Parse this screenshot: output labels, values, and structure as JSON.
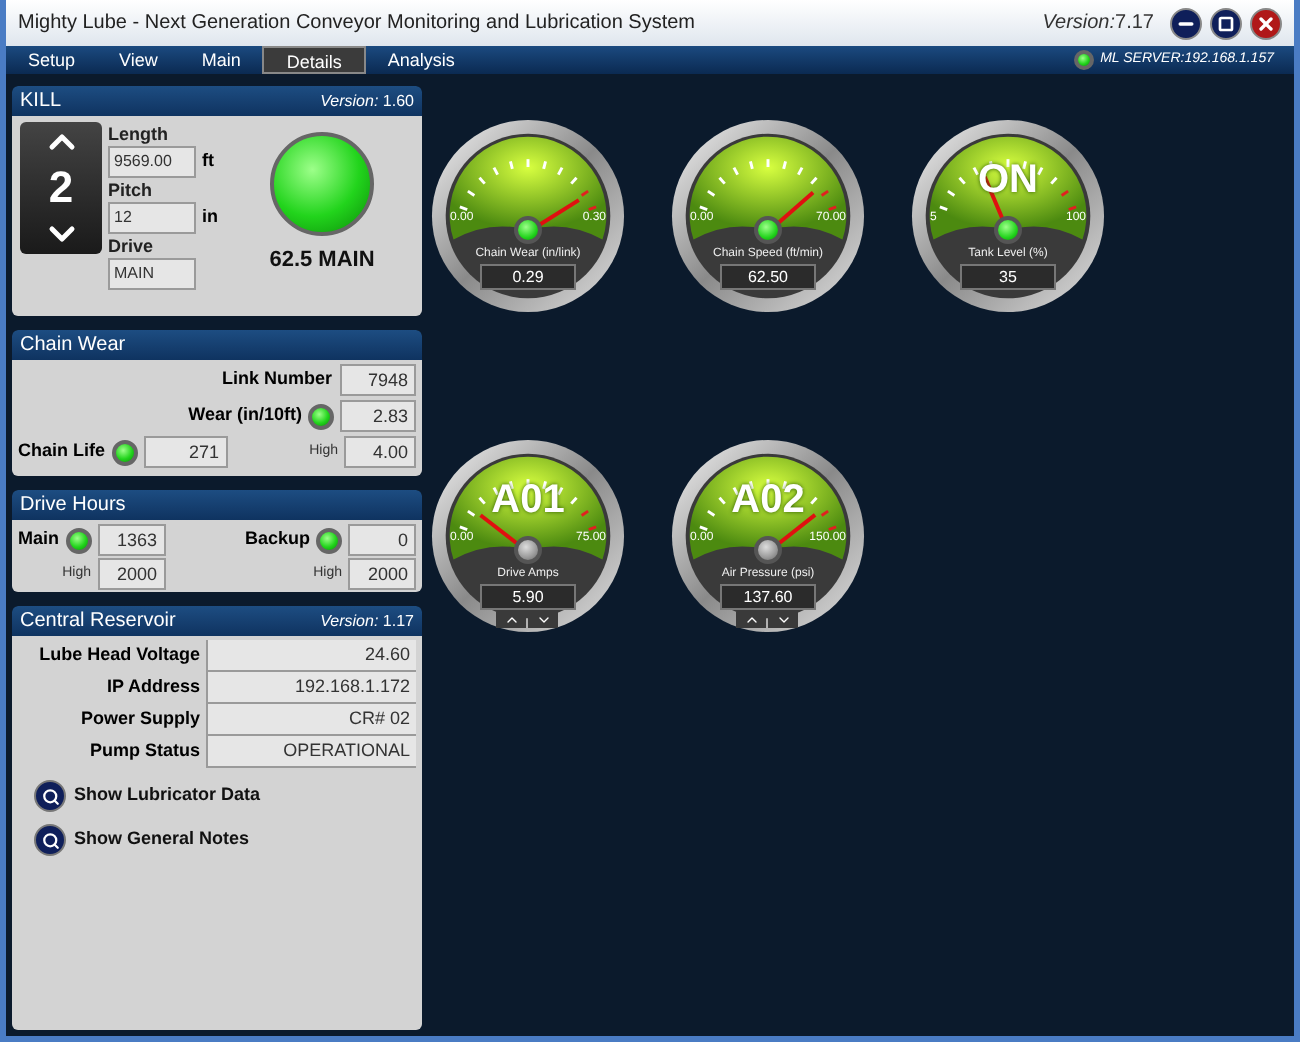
{
  "window": {
    "title": "Mighty Lube - Next Generation Conveyor Monitoring and Lubrication System",
    "version_label": "Version:",
    "version": "7.17"
  },
  "menu": [
    {
      "label": "Setup",
      "selected": false
    },
    {
      "label": "View",
      "selected": false
    },
    {
      "label": "Main",
      "selected": false
    },
    {
      "label": "Details",
      "selected": true
    },
    {
      "label": "Analysis",
      "selected": false
    }
  ],
  "server_status": {
    "on": true,
    "label": "ML SERVER:192.168.1.157"
  },
  "kill_panel": {
    "title": "KILL",
    "version_label": "Version:",
    "version": "1.60",
    "spinner_value": "2",
    "fields": [
      {
        "label": "Length",
        "value": "9569.00",
        "unit": "ft"
      },
      {
        "label": "Pitch",
        "value": "12",
        "unit": "in"
      },
      {
        "label": "Drive",
        "value": "MAIN"
      }
    ],
    "status_light_on": true,
    "status_text": "62.5 MAIN"
  },
  "chain_wear": {
    "title": "Chain Wear",
    "link_number": {
      "label": "Link Number",
      "value": "7948"
    },
    "wear": {
      "label": "Wear (in/10ft)",
      "light_on": true,
      "value": "2.83",
      "high_label": "High",
      "high": "4.00"
    },
    "chain_life": {
      "label": "Chain Life",
      "light_on": true,
      "value": "271"
    }
  },
  "drive_hours": {
    "title": "Drive Hours",
    "items": [
      {
        "label": "Main",
        "light_on": true,
        "value": "1363",
        "high_label": "High",
        "high": "2000"
      },
      {
        "label": "Backup",
        "light_on": true,
        "value": "0",
        "high_label": "High",
        "high": "2000"
      }
    ]
  },
  "central_reservoir": {
    "title": "Central Reservoir",
    "version_label": "Version:",
    "version": "1.17",
    "rows": [
      {
        "label": "Lube Head Voltage",
        "value": "24.60"
      },
      {
        "label": "IP Address",
        "value": "192.168.1.172"
      },
      {
        "label": "Power Supply",
        "value": "CR# 02"
      },
      {
        "label": "Pump Status",
        "value": "OPERATIONAL"
      }
    ],
    "actions": [
      "Show Lubricator Data",
      "Show General Notes"
    ]
  },
  "gauges": [
    {
      "kind": "display",
      "title": "Chain Wear (in/link)",
      "min": "0.00",
      "max": "0.30",
      "value": "0.29",
      "hub_on": true
    },
    {
      "kind": "display",
      "title": "Chain Speed (ft/min)",
      "min": "0.00",
      "max": "70.00",
      "value": "62.50",
      "hub_on": true
    },
    {
      "kind": "display",
      "title": "Tank Level (%)",
      "min": "5",
      "max": "100",
      "value": "35",
      "overlay": "ON",
      "hub_on": true
    },
    {
      "kind": "adjustable",
      "title": "Drive Amps",
      "min": "0.00",
      "max": "75.00",
      "value": "5.90",
      "overlay": "A01",
      "hub_on": false
    },
    {
      "kind": "adjustable",
      "title": "Air Pressure (psi)",
      "min": "0.00",
      "max": "150.00",
      "value": "137.60",
      "overlay": "A02",
      "hub_on": false
    }
  ]
}
